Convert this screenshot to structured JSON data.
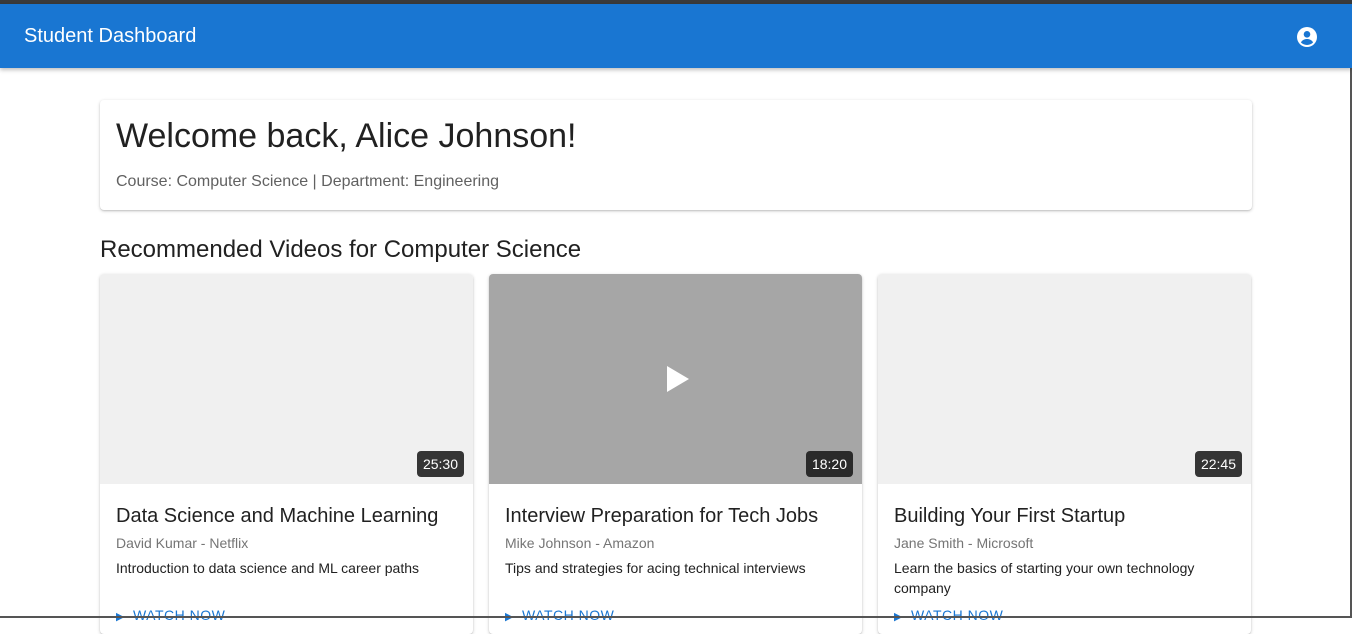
{
  "appbar": {
    "title": "Student Dashboard",
    "account_icon": "account-circle-icon",
    "color": "#1976d2"
  },
  "welcome": {
    "title": "Welcome back, Alice Johnson!",
    "subtitle": "Course: Computer Science | Department: Engineering"
  },
  "section": {
    "title": "Recommended Videos for Computer Science"
  },
  "videos": [
    {
      "title": "Data Science and Machine Learning",
      "author": "David Kumar - Netflix",
      "description": "Introduction to data science and ML career paths",
      "duration": "25:30",
      "action": "WATCH NOW"
    },
    {
      "title": "Interview Preparation for Tech Jobs",
      "author": "Mike Johnson - Amazon",
      "description": "Tips and strategies for acing technical interviews",
      "duration": "18:20",
      "action": "WATCH NOW"
    },
    {
      "title": "Building Your First Startup",
      "author": "Jane Smith - Microsoft",
      "description": "Learn the basics of starting your own technology company",
      "duration": "22:45",
      "action": "WATCH NOW"
    }
  ]
}
